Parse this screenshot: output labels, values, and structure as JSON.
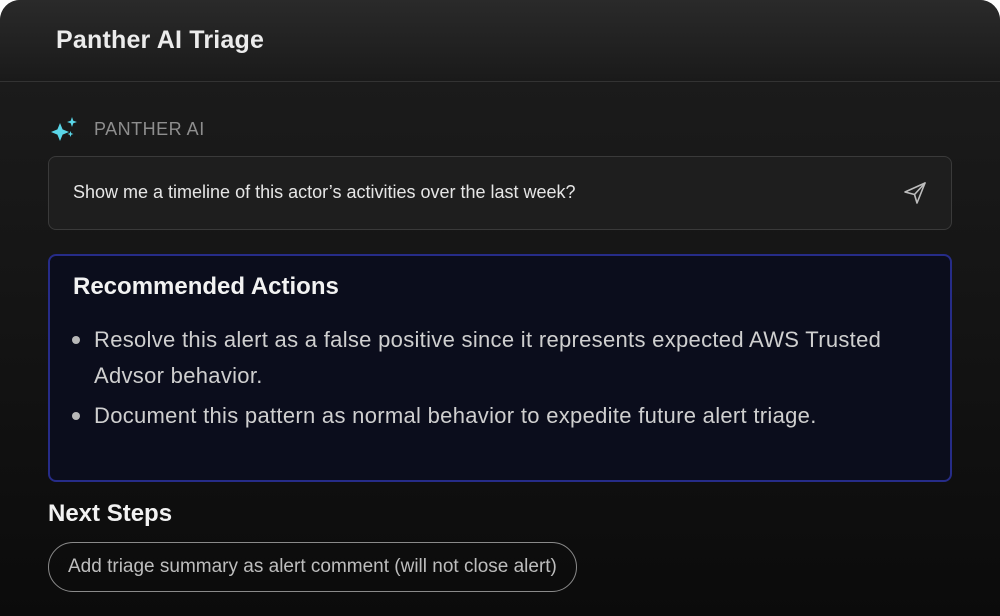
{
  "window": {
    "title": "Panther AI Triage"
  },
  "assistant": {
    "label": "PANTHER AI",
    "icon": "sparkle-icon",
    "accent_color": "#5ad6e8"
  },
  "query": {
    "value": "Show me a timeline of this actor’s activities over the last week?",
    "send_icon": "send-icon"
  },
  "recommended": {
    "title": "Recommended Actions",
    "border_color": "#262c88",
    "items": [
      "Resolve this alert as a false positive since it represents expected AWS Trusted Advsor behavior.",
      "Document this pattern as normal behavior to expedite future alert triage."
    ]
  },
  "next_steps": {
    "title": "Next Steps",
    "button_label": "Add triage summary as alert comment (will not close alert)"
  }
}
